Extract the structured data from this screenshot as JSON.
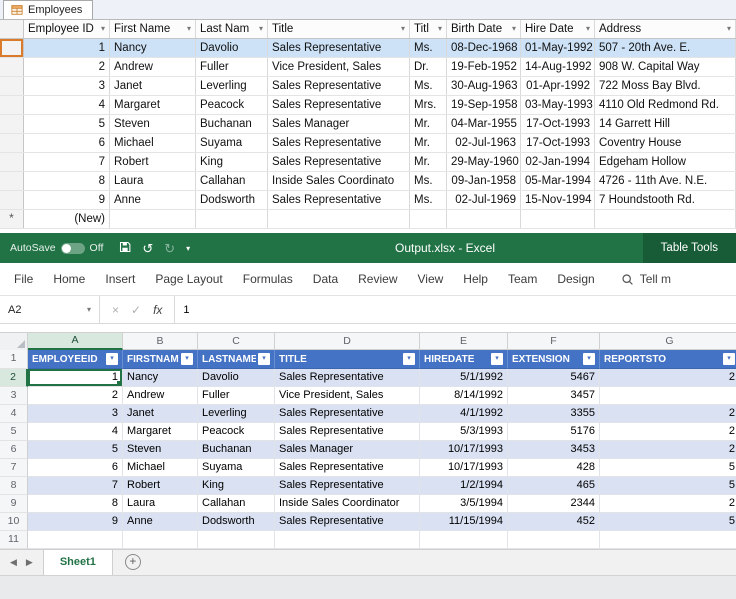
{
  "colors": {
    "excel_green": "#217346",
    "table_tools_green": "#185C37",
    "table_header_blue": "#4472C4",
    "banded_row_blue": "#D9E1F2",
    "access_selected_row": "#CDE2F6",
    "record_marker_orange": "#D97B2A"
  },
  "icons": {
    "chevron_down": "▾",
    "undo": "↺",
    "redo": "↻",
    "cancel": "×",
    "enter": "✓",
    "prev_sheet": "◀",
    "next_sheet": "▶",
    "new_sheet": "+"
  },
  "access": {
    "tab_label": "Employees",
    "columns": [
      "Employee ID",
      "First Name",
      "Last Nam",
      "Title",
      "Titl",
      "Birth Date",
      "Hire Date",
      "Address"
    ],
    "rows": [
      [
        "1",
        "Nancy",
        "Davolio",
        "Sales Representative",
        "Ms.",
        "08-Dec-1968",
        "01-May-1992",
        "507 - 20th Ave. E."
      ],
      [
        "2",
        "Andrew",
        "Fuller",
        "Vice President, Sales",
        "Dr.",
        "19-Feb-1952",
        "14-Aug-1992",
        "908 W. Capital Way"
      ],
      [
        "3",
        "Janet",
        "Leverling",
        "Sales Representative",
        "Ms.",
        "30-Aug-1963",
        "01-Apr-1992",
        "722 Moss Bay Blvd."
      ],
      [
        "4",
        "Margaret",
        "Peacock",
        "Sales Representative",
        "Mrs.",
        "19-Sep-1958",
        "03-May-1993",
        "4110 Old Redmond Rd."
      ],
      [
        "5",
        "Steven",
        "Buchanan",
        "Sales Manager",
        "Mr.",
        "04-Mar-1955",
        "17-Oct-1993",
        "14 Garrett Hill"
      ],
      [
        "6",
        "Michael",
        "Suyama",
        "Sales Representative",
        "Mr.",
        "02-Jul-1963",
        "17-Oct-1993",
        "Coventry House"
      ],
      [
        "7",
        "Robert",
        "King",
        "Sales Representative",
        "Mr.",
        "29-May-1960",
        "02-Jan-1994",
        "Edgeham Hollow"
      ],
      [
        "8",
        "Laura",
        "Callahan",
        "Inside Sales Coordinato",
        "Ms.",
        "09-Jan-1958",
        "05-Mar-1994",
        "4726 - 11th Ave. N.E."
      ],
      [
        "9",
        "Anne",
        "Dodsworth",
        "Sales Representative",
        "Ms.",
        "02-Jul-1969",
        "15-Nov-1994",
        "7 Houndstooth Rd."
      ]
    ],
    "new_row": {
      "marker": "*",
      "label": "(New)"
    }
  },
  "excel": {
    "titlebar": {
      "autosave_label": "AutoSave",
      "autosave_state": "Off",
      "title": "Output.xlsx - Excel",
      "context_tab_group": "Table Tools"
    },
    "ribbon_tabs": [
      "File",
      "Home",
      "Insert",
      "Page Layout",
      "Formulas",
      "Data",
      "Review",
      "View",
      "Help",
      "Team",
      "Design"
    ],
    "contextual_tab": "Design",
    "tell_me": "Tell m",
    "name_box": "A2",
    "formula_value": "1",
    "fx_label": "fx",
    "column_letters": [
      "A",
      "B",
      "C",
      "D",
      "E",
      "F",
      "G"
    ],
    "header_row_number": "1",
    "table_headers": [
      "EMPLOYEEID",
      "FIRSTNAME",
      "LASTNAME",
      "TITLE",
      "HIREDATE",
      "EXTENSION",
      "REPORTSTO"
    ],
    "rows": [
      {
        "n": "2",
        "cells": [
          "1",
          "Nancy",
          "Davolio",
          "Sales Representative",
          "5/1/1992",
          "5467",
          "2"
        ]
      },
      {
        "n": "3",
        "cells": [
          "2",
          "Andrew",
          "Fuller",
          "Vice President, Sales",
          "8/14/1992",
          "3457",
          ""
        ]
      },
      {
        "n": "4",
        "cells": [
          "3",
          "Janet",
          "Leverling",
          "Sales Representative",
          "4/1/1992",
          "3355",
          "2"
        ]
      },
      {
        "n": "5",
        "cells": [
          "4",
          "Margaret",
          "Peacock",
          "Sales Representative",
          "5/3/1993",
          "5176",
          "2"
        ]
      },
      {
        "n": "6",
        "cells": [
          "5",
          "Steven",
          "Buchanan",
          "Sales Manager",
          "10/17/1993",
          "3453",
          "2"
        ]
      },
      {
        "n": "7",
        "cells": [
          "6",
          "Michael",
          "Suyama",
          "Sales Representative",
          "10/17/1993",
          "428",
          "5"
        ]
      },
      {
        "n": "8",
        "cells": [
          "7",
          "Robert",
          "King",
          "Sales Representative",
          "1/2/1994",
          "465",
          "5"
        ]
      },
      {
        "n": "9",
        "cells": [
          "8",
          "Laura",
          "Callahan",
          "Inside Sales Coordinator",
          "3/5/1994",
          "2344",
          "2"
        ]
      },
      {
        "n": "10",
        "cells": [
          "9",
          "Anne",
          "Dodsworth",
          "Sales Representative",
          "11/15/1994",
          "452",
          "5"
        ]
      },
      {
        "n": "11",
        "cells": [
          "",
          "",
          "",
          "",
          "",
          "",
          ""
        ]
      }
    ],
    "sheet_tab": "Sheet1"
  }
}
